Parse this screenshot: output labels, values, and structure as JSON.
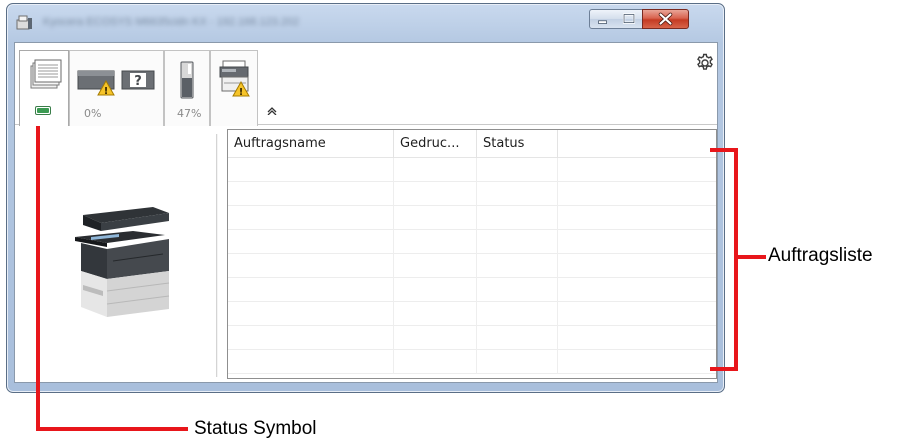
{
  "window": {
    "title": "Kyocera ECOSYS M6635cidn KX - 192.168.123.202"
  },
  "toolbar": {
    "tabs": [
      {
        "id": "status",
        "icon": "printer-pages-icon",
        "status_color": "#3b9a52"
      },
      {
        "id": "toner-paper",
        "icon": "toner-paper-warning-icon",
        "value": "0%"
      },
      {
        "id": "waste-toner",
        "icon": "toner-level-icon",
        "value": "47%"
      },
      {
        "id": "device",
        "icon": "device-warning-icon"
      }
    ],
    "settings_icon": "gear-icon",
    "collapse_icon": "chevron-up-double-icon"
  },
  "job_list": {
    "columns": [
      "Auftragsname",
      "Gedruc...",
      "Status"
    ],
    "rows": []
  },
  "callouts": {
    "job_list_label": "Auftragsliste",
    "status_symbol_label": "Status Symbol",
    "color": "#e8161b"
  }
}
